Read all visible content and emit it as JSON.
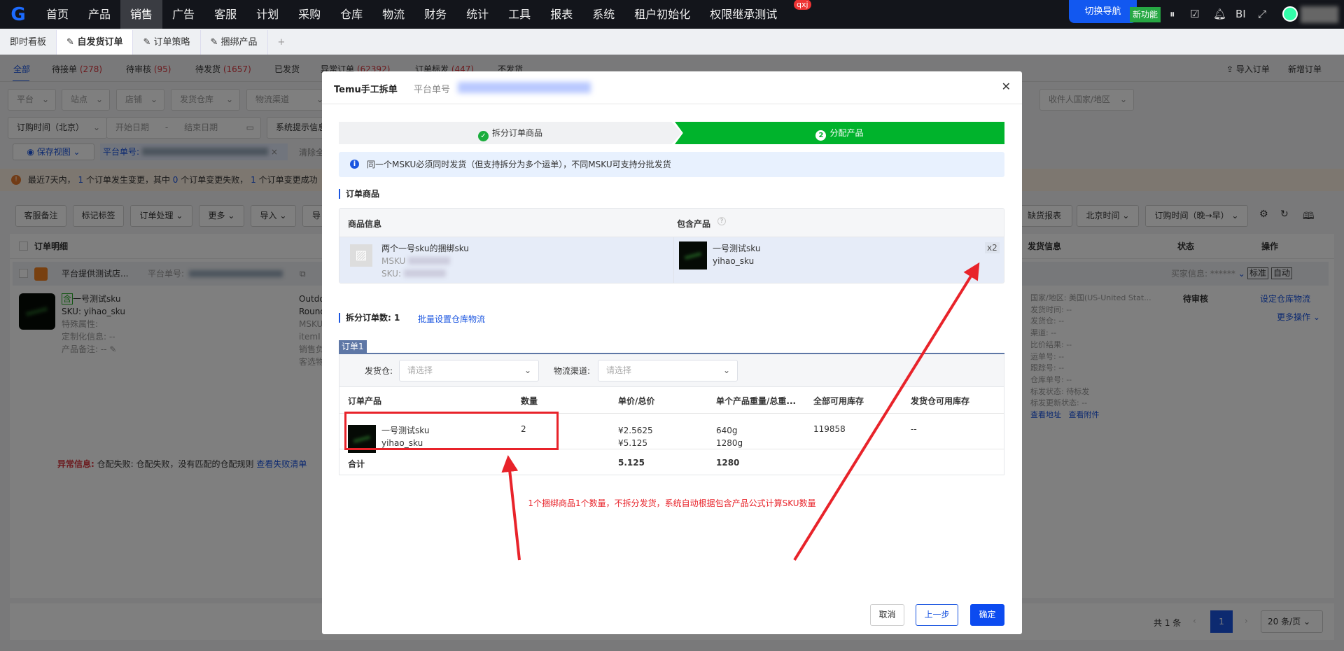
{
  "topnav": {
    "items": [
      "首页",
      "产品",
      "销售",
      "广告",
      "客服",
      "计划",
      "采购",
      "仓库",
      "物流",
      "财务",
      "统计",
      "工具",
      "报表",
      "系统",
      "租户初始化",
      "权限继承测试"
    ],
    "active": "销售",
    "badge": "qxj",
    "switch_nav": "切换导航",
    "new_feature": "新功能",
    "bi": "BI"
  },
  "page_tabs": [
    {
      "label": "即时看板"
    },
    {
      "label": "自发货订单"
    },
    {
      "label": "订单策略"
    },
    {
      "label": "捆绑产品"
    },
    {
      "label": "+"
    }
  ],
  "status_tabs": [
    {
      "label": "全部",
      "count": ""
    },
    {
      "label": "待接单",
      "count": "(278)"
    },
    {
      "label": "待审核",
      "count": "(95)"
    },
    {
      "label": "待发货",
      "count": "(1657)"
    },
    {
      "label": "已发货",
      "count": ""
    },
    {
      "label": "异常订单",
      "count": "(62392)"
    },
    {
      "label": "订单标发",
      "count": "(447)"
    },
    {
      "label": "不发货",
      "count": ""
    }
  ],
  "header_actions": {
    "import": "导入订单",
    "add": "新增订单"
  },
  "filters": {
    "platform": "平台",
    "site": "站点",
    "store": "店铺",
    "warehouse": "发货仓库",
    "channel": "物流渠道",
    "country": "收件人国家/地区",
    "time_type": "订购时间（北京）",
    "start": "开始日期",
    "sep": "-",
    "end": "结束日期",
    "sys_info": "系统提示信息",
    "save_view": "保存视图",
    "platform_order_label": "平台单号:",
    "clear": "清除全"
  },
  "notice": {
    "p1": "最近7天内，",
    "n1": "1",
    "p2": "个订单发生变更，其中",
    "n2": "0",
    "p3": "个订单变更失败，",
    "n3": "1",
    "p4": "个订单变更成功"
  },
  "toolbar": {
    "note": "客服备注",
    "tag": "标记标签",
    "process": "订单处理",
    "more": "更多",
    "import": "导入",
    "export": "导",
    "shortage": "缺货报表",
    "tz": "北京时间",
    "sort": "订购时间（晚→早）"
  },
  "order_table": {
    "headers": {
      "detail": "订单明细",
      "ship": "发货信息",
      "status": "状态",
      "ops": "操作"
    },
    "store": "平台提供测试店...",
    "platform_order_label": "平台单号:",
    "buyer_label": "买家信息:",
    "buyer_value": "******",
    "tag_standard": "标准",
    "tag_auto": "自动",
    "item": {
      "tag": "含",
      "name": "一号测试sku",
      "sku": "SKU:  yihao_sku",
      "special": "特殊属性:",
      "custom": "定制化信息:  --",
      "remark": "产品备注:  --"
    },
    "mid_col": [
      "Outdo",
      "Round",
      "MSKU",
      "itemI",
      "销售负",
      "客选物"
    ],
    "ship_info": [
      "国家/地区:  美国(US-United Stat...",
      "发货时间:  --",
      "发货仓:  --",
      "渠道:  --",
      "比价结果:  --",
      "运单号:  --",
      "跟踪号:  --",
      "仓库单号:  --",
      "标发状态:  待标发",
      "标发更新状态:  --"
    ],
    "view_address": "查看地址",
    "view_attach": "查看附件",
    "status": "待审核",
    "set_wh": "设定仓库物流",
    "more_ops": "更多操作",
    "exception_label": "异常信息:",
    "exception_text": "仓配失败: 仓配失败，没有匹配的仓配规则",
    "exception_link": "查看失败清单"
  },
  "pagination": {
    "total": "共 1 条",
    "page": "1",
    "size": "20 条/页"
  },
  "modal": {
    "title": "Temu手工拆单",
    "sub_label": "平台单号",
    "steps": [
      {
        "label": "拆分订单商品",
        "state": "done"
      },
      {
        "label": "分配产品",
        "num": "2",
        "state": "active"
      }
    ],
    "alert": "同一个MSKU必须同时发货（但支持拆分为多个运单），不同MSKU可支持分批发货",
    "section_goods": "订单商品",
    "goods_headers": {
      "info": "商品信息",
      "contains": "包含产品"
    },
    "goods": {
      "name": "两个一号sku的捆绑sku",
      "msku_label": "MSKU",
      "sku_label": "SKU:",
      "contains_name": "一号测试sku",
      "contains_sku": "yihao_sku",
      "multiplier": "x2"
    },
    "split_label": "拆分订单数:",
    "split_count": "1",
    "batch_link": "批量设置仓库物流",
    "order_tab": "订单1",
    "warehouse_label": "发货仓:",
    "warehouse_placeholder": "请选择",
    "channel_label": "物流渠道:",
    "channel_placeholder": "请选择",
    "columns": [
      "订单产品",
      "数量",
      "单价/总价",
      "单个产品重量/总重...",
      "全部可用库存",
      "发货仓可用库存"
    ],
    "row": {
      "name": "一号测试sku",
      "sku": "yihao_sku",
      "qty": "2",
      "unit_price": "¥2.5625",
      "total_price": "¥5.125",
      "unit_weight": "640g",
      "total_weight": "1280g",
      "stock_all": "119858",
      "stock_wh": "--"
    },
    "total": {
      "label": "合计",
      "price": "5.125",
      "weight": "1280"
    },
    "annotation": "1个捆绑商品1个数量，不拆分发货，系统自动根据包含产品公式计算SKU数量",
    "buttons": {
      "cancel": "取消",
      "prev": "上一步",
      "confirm": "确定"
    }
  },
  "colors": {
    "primary": "#1a55e0",
    "success": "#00b32c",
    "annotation": "#e8232a",
    "nav_bg": "#13151b"
  }
}
